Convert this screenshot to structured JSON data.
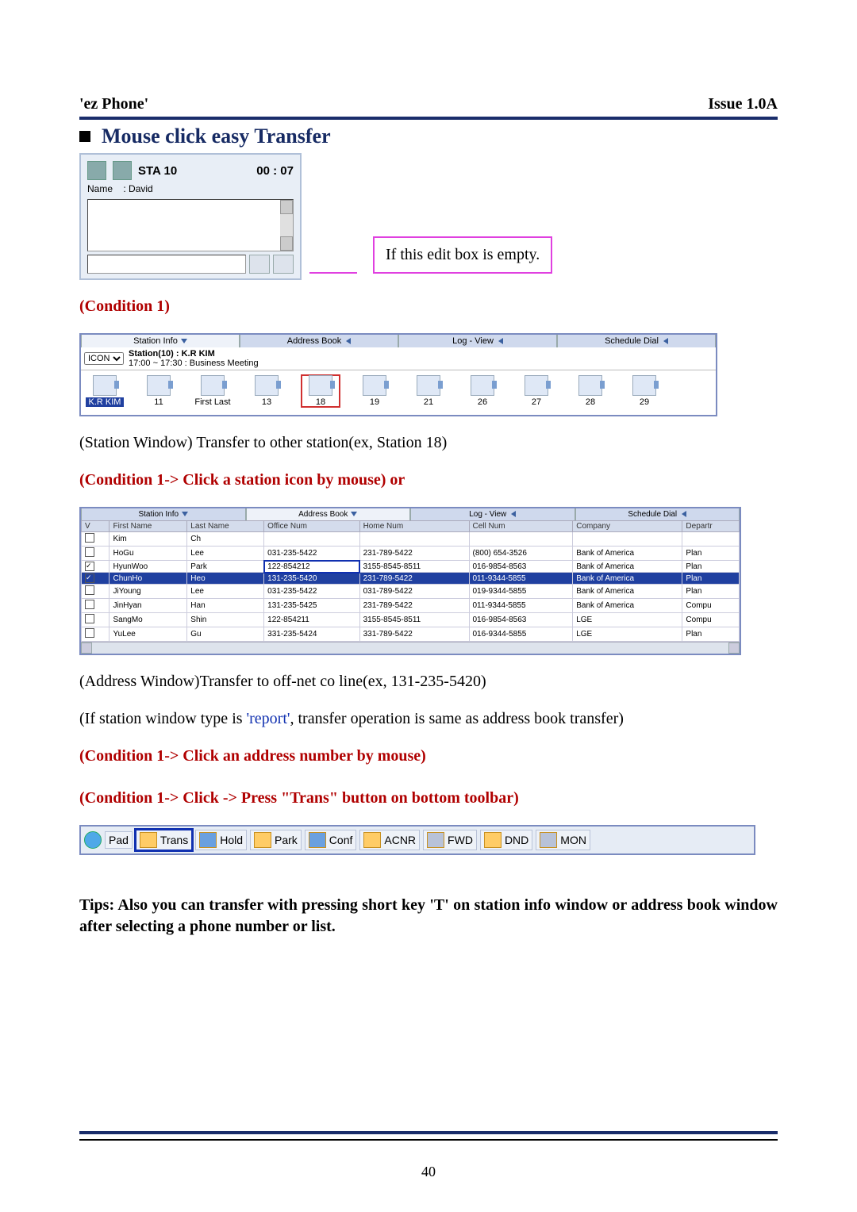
{
  "header": {
    "left": "'ez Phone'",
    "right": "Issue 1.0A"
  },
  "page_number": "40",
  "section_title": "Mouse click easy Transfer",
  "phone_panel": {
    "station_label": "STA 10",
    "timer": "00 : 07",
    "name_field_label": "Name",
    "name_value": "David"
  },
  "callout_text": "If this edit box is empty.",
  "labels": {
    "condition1": "(Condition 1)",
    "station_caption": "(Station Window) Transfer to other station(ex, Station 18)",
    "station_action": "(Condition 1-> Click a station icon by mouse) or",
    "address_caption": "(Address Window)Transfer to off-net co line(ex, 131-235-5420)",
    "report_pre": "(If station window type is ",
    "report_link": "'report'",
    "report_post": ", transfer operation is same as address book transfer)",
    "address_action": "(Condition 1-> Click an address number by mouse)",
    "toolbar_action": "(Condition 1-> Click -> Press \"Trans\" button on bottom toolbar)",
    "tips": "Tips: Also you can transfer with pressing short key 'T' on station info window or address book window after selecting a phone number or list."
  },
  "station_window": {
    "tabs": [
      "Station Info",
      "Address Book",
      "Log - View",
      "Schedule Dial"
    ],
    "dropdown": "ICON",
    "info_line": "Station(10) :  K.R KIM",
    "info_line2": "17:00 ~ 17:30 : Business Meeting",
    "icons": [
      {
        "label": "K.R KIM",
        "selected": true
      },
      {
        "label": "11"
      },
      {
        "label": "First Last"
      },
      {
        "label": "13"
      },
      {
        "label": "18",
        "highlight": true
      },
      {
        "label": "19"
      },
      {
        "label": "21"
      },
      {
        "label": "26"
      },
      {
        "label": "27"
      },
      {
        "label": "28"
      },
      {
        "label": "29"
      }
    ]
  },
  "address_window": {
    "tabs": [
      "Station Info",
      "Address Book",
      "Log - View",
      "Schedule Dial"
    ],
    "columns": [
      "V",
      "First Name",
      "Last Name",
      "Office Num",
      "Home Num",
      "Cell Num",
      "Company",
      "Departr"
    ],
    "rows": [
      {
        "v": false,
        "first": "Kim",
        "last": "Ch",
        "office": "",
        "home": "",
        "cell": "",
        "company": "",
        "dept": ""
      },
      {
        "v": false,
        "first": "HoGu",
        "last": "Lee",
        "office": "031-235-5422",
        "home": "231-789-5422",
        "cell": "(800) 654-3526",
        "company": "Bank of America",
        "dept": "Plan"
      },
      {
        "v": true,
        "first": "HyunWoo",
        "last": "Park",
        "office": "122-854212",
        "home": "3155-8545-8511",
        "cell": "016-9854-8563",
        "company": "Bank of America",
        "dept": "Plan",
        "officeMark": true
      },
      {
        "v": true,
        "first": "ChunHo",
        "last": "Heo",
        "office": "131-235-5420",
        "home": "231-789-5422",
        "cell": "011-9344-5855",
        "company": "Bank of America",
        "dept": "Plan",
        "selected": true
      },
      {
        "v": false,
        "first": "JiYoung",
        "last": "Lee",
        "office": "031-235-5422",
        "home": "031-789-5422",
        "cell": "019-9344-5855",
        "company": "Bank of America",
        "dept": "Plan"
      },
      {
        "v": false,
        "first": "JinHyan",
        "last": "Han",
        "office": "131-235-5425",
        "home": "231-789-5422",
        "cell": "011-9344-5855",
        "company": "Bank of America",
        "dept": "Compu"
      },
      {
        "v": false,
        "first": "SangMo",
        "last": "Shin",
        "office": "122-854211",
        "home": "3155-8545-8511",
        "cell": "016-9854-8563",
        "company": "LGE",
        "dept": "Compu"
      },
      {
        "v": false,
        "first": "YuLee",
        "last": "Gu",
        "office": "331-235-5424",
        "home": "331-789-5422",
        "cell": "016-9344-5855",
        "company": "LGE",
        "dept": "Plan"
      }
    ]
  },
  "toolbar": {
    "buttons": [
      "Pad",
      "Trans",
      "Hold",
      "Park",
      "Conf",
      "ACNR",
      "FWD",
      "DND",
      "MON"
    ]
  }
}
